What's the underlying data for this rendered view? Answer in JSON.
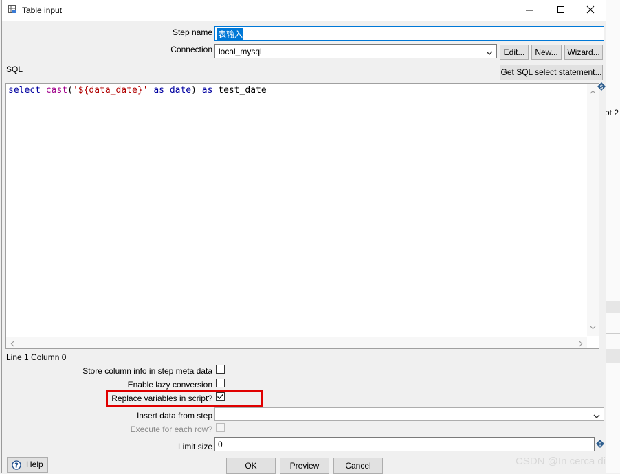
{
  "window": {
    "title": "Table input",
    "minimize": "—",
    "maximize": "☐",
    "close": "✕"
  },
  "form": {
    "step_name_label": "Step name",
    "step_name_value": "表输入",
    "connection_label": "Connection",
    "connection_value": "local_mysql",
    "edit_button": "Edit...",
    "new_button": "New...",
    "wizard_button": "Wizard...",
    "sql_label": "SQL",
    "get_sql_button": "Get SQL select statement...",
    "sql": {
      "kw_select": "select",
      "fn_cast": "cast",
      "paren_open": "(",
      "string_literal": "'${data_date}'",
      "kw_as1": "as",
      "type_date": "date",
      "paren_close": ")",
      "kw_as2": "as",
      "alias": "test_date"
    },
    "cursor_position": "Line 1 Column 0",
    "store_column_label": "Store column info in step meta data",
    "store_column_checked": false,
    "lazy_conversion_label": "Enable lazy conversion",
    "lazy_conversion_checked": false,
    "replace_variables_label": "Replace variables in script?",
    "replace_variables_checked": true,
    "insert_data_label": "Insert data from step",
    "insert_data_value": "",
    "execute_each_row_label": "Execute for each row?",
    "execute_each_row_checked": false,
    "limit_size_label": "Limit size",
    "limit_size_value": "0"
  },
  "footer": {
    "help_button": "Help",
    "ok_button": "OK",
    "preview_button": "Preview",
    "cancel_button": "Cancel"
  },
  "background": {
    "partial_text": "ot 2",
    "watermark": "CSDN @In cerca di"
  },
  "colors": {
    "highlight_box": "#e00000",
    "selection": "#0078d7",
    "sql_keyword": "#0000a0",
    "sql_string": "#b00000",
    "sql_function": "#a0008a"
  }
}
